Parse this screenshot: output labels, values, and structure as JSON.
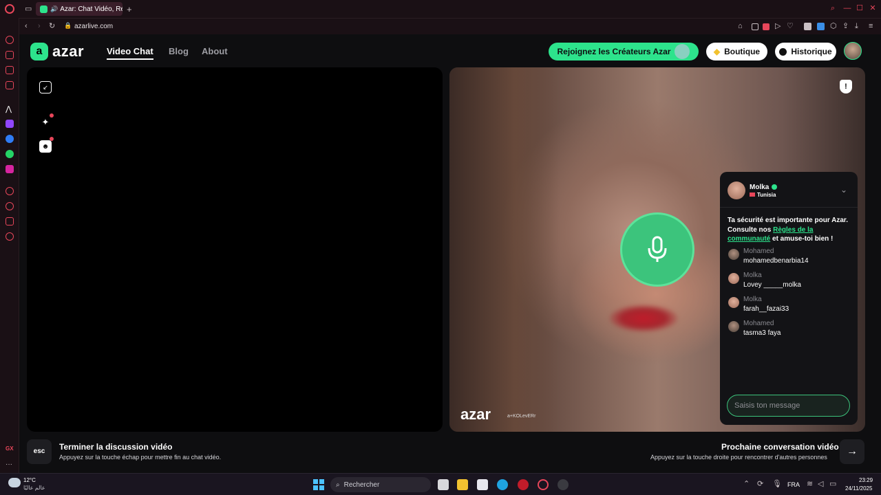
{
  "browser": {
    "tab_title": "Azar: Chat Vidéo, Ren",
    "url": "azarlive.com"
  },
  "header": {
    "logo": "azar",
    "nav": [
      "Video Chat",
      "Blog",
      "About"
    ],
    "creators_button": "Rejoignez les Créateurs Azar",
    "shop_button": "Boutique",
    "history_button": "Historique"
  },
  "chat": {
    "user_name": "Molka",
    "user_country": "Tunisia",
    "safety_text_1": "Ta sécurité est importante pour Azar. Consulte nos ",
    "safety_link": "Règles de la communauté",
    "safety_text_2": " et amuse-toi bien !",
    "messages": [
      {
        "name": "Mohamed",
        "text": "mohamedbenarbia14"
      },
      {
        "name": "Molka",
        "text": "Lovey _____molka"
      },
      {
        "name": "Molka",
        "text": "farah__fazai33"
      },
      {
        "name": "Mohamed",
        "text": "tasma3 faya"
      }
    ],
    "input_placeholder": "Saisis ton message"
  },
  "video": {
    "watermark": "azar",
    "watermark_sub": "a+KOLevERr"
  },
  "bottom": {
    "esc_key": "esc",
    "end_title": "Terminer la discussion vidéo",
    "end_sub": "Appuyez sur la touche échap pour mettre fin au chat vidéo.",
    "next_title": "Prochaine conversation vidéo",
    "next_sub": "Appuyez sur la touche droite pour rencontrer d'autres personnes"
  },
  "taskbar": {
    "temp": "12°C",
    "weather_text": "عالم عالیًا",
    "search": "Rechercher",
    "lang": "FRA",
    "time": "23:29",
    "date": "24/11/2025"
  },
  "colors": {
    "accent": "#2de38c",
    "mic_bg": "#3cc47c",
    "alert": "#e8465a"
  }
}
